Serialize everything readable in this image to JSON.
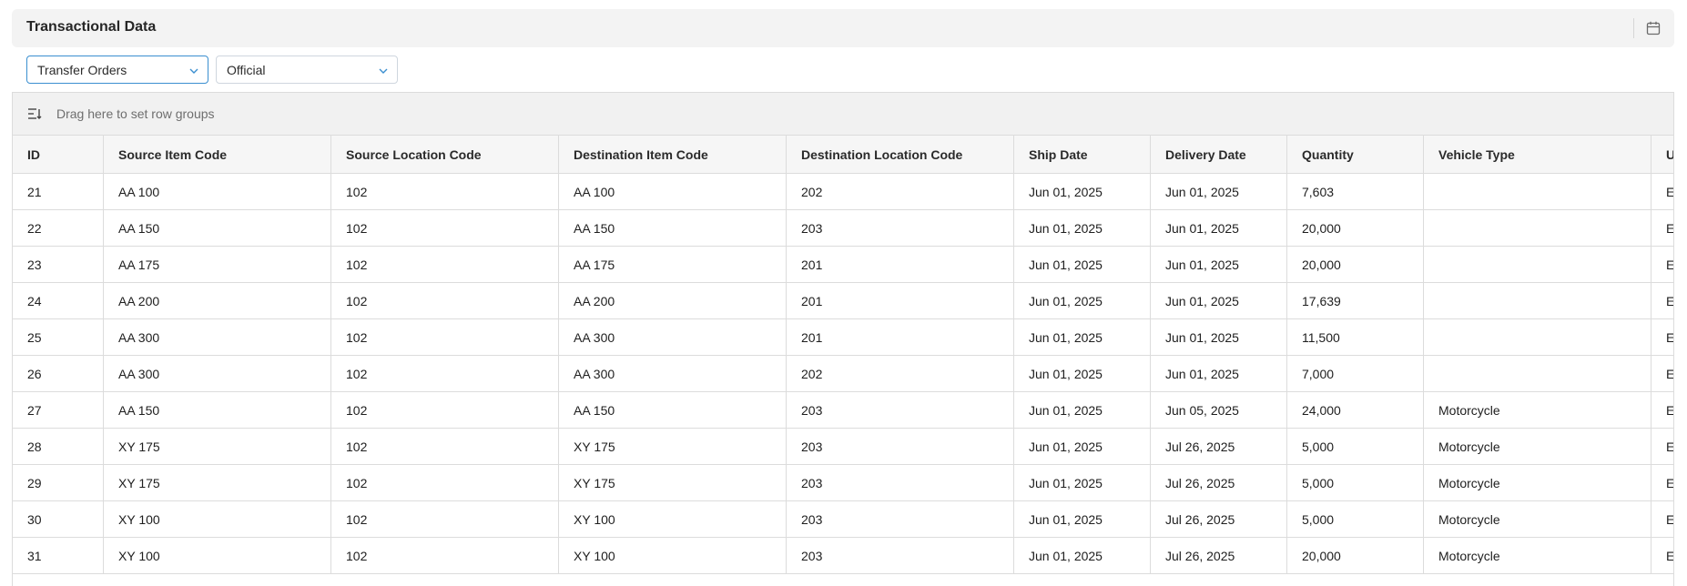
{
  "header": {
    "title": "Transactional Data",
    "calendar_icon": "calendar-icon"
  },
  "filters": {
    "order_type": "Transfer Orders",
    "version": "Official",
    "chevron_icon": "chevron-down-icon"
  },
  "grid": {
    "group_bar_text": "Drag here to set row groups",
    "group_icon": "row-groups-icon",
    "columns": [
      "ID",
      "Source Item Code",
      "Source Location Code",
      "Destination Item Code",
      "Destination Location Code",
      "Ship Date",
      "Delivery Date",
      "Quantity",
      "Vehicle Type",
      "U"
    ],
    "rows": [
      [
        "21",
        "AA 100",
        "102",
        "AA 100",
        "202",
        "Jun 01, 2025",
        "Jun 01, 2025",
        "7,603",
        "",
        "E"
      ],
      [
        "22",
        "AA 150",
        "102",
        "AA 150",
        "203",
        "Jun 01, 2025",
        "Jun 01, 2025",
        "20,000",
        "",
        "E"
      ],
      [
        "23",
        "AA 175",
        "102",
        "AA 175",
        "201",
        "Jun 01, 2025",
        "Jun 01, 2025",
        "20,000",
        "",
        "E"
      ],
      [
        "24",
        "AA 200",
        "102",
        "AA 200",
        "201",
        "Jun 01, 2025",
        "Jun 01, 2025",
        "17,639",
        "",
        "E"
      ],
      [
        "25",
        "AA 300",
        "102",
        "AA 300",
        "201",
        "Jun 01, 2025",
        "Jun 01, 2025",
        "11,500",
        "",
        "E"
      ],
      [
        "26",
        "AA 300",
        "102",
        "AA 300",
        "202",
        "Jun 01, 2025",
        "Jun 01, 2025",
        "7,000",
        "",
        "E"
      ],
      [
        "27",
        "AA 150",
        "102",
        "AA 150",
        "203",
        "Jun 01, 2025",
        "Jun 05, 2025",
        "24,000",
        "Motorcycle",
        "E"
      ],
      [
        "28",
        "XY 175",
        "102",
        "XY 175",
        "203",
        "Jun 01, 2025",
        "Jul 26, 2025",
        "5,000",
        "Motorcycle",
        "E"
      ],
      [
        "29",
        "XY 175",
        "102",
        "XY 175",
        "203",
        "Jun 01, 2025",
        "Jul 26, 2025",
        "5,000",
        "Motorcycle",
        "E"
      ],
      [
        "30",
        "XY 100",
        "102",
        "XY 100",
        "203",
        "Jun 01, 2025",
        "Jul 26, 2025",
        "5,000",
        "Motorcycle",
        "E"
      ],
      [
        "31",
        "XY 100",
        "102",
        "XY 100",
        "203",
        "Jun 01, 2025",
        "Jul 26, 2025",
        "20,000",
        "Motorcycle",
        "E"
      ]
    ]
  }
}
